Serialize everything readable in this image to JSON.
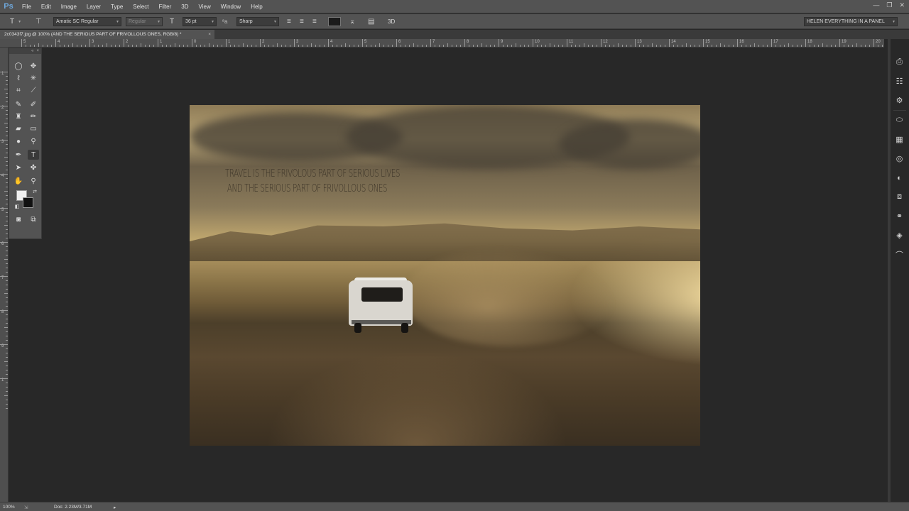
{
  "app": {
    "logo": "Ps"
  },
  "menu": [
    "File",
    "Edit",
    "Image",
    "Layer",
    "Type",
    "Select",
    "Filter",
    "3D",
    "View",
    "Window",
    "Help"
  ],
  "window_controls": [
    "—",
    "❐",
    "✕"
  ],
  "options": {
    "font_family": "Amatic SC Regular",
    "font_style": "Regular",
    "font_size": "36 pt",
    "aa_label": "ªa",
    "antialias": "Sharp",
    "warp_label": "3D",
    "text_color": "#1b1b1b",
    "workspace": "HELEN EVERYTHING IN A PANEL"
  },
  "document": {
    "tab_title": "2c0343f7.jpg @ 100% (AND THE SERIOUS PART OF FRIVOLLOUS ONES, RGB/8) *",
    "tab_close": "×"
  },
  "ruler": {
    "h_labels": [
      "5",
      "4",
      "3",
      "2",
      "1",
      "0",
      "1",
      "2",
      "3",
      "4",
      "5",
      "6",
      "7",
      "8",
      "9",
      "10",
      "11",
      "12",
      "13",
      "14",
      "15",
      "16",
      "17",
      "18",
      "19",
      "20"
    ],
    "v_labels": [
      "1",
      "2",
      "3",
      "4",
      "5",
      "6",
      "7",
      "8",
      "9",
      "1"
    ]
  },
  "canvas": {
    "quote_line1": "TRAVEL IS THE FRIVOLOUS PART OF SERIOUS LIVES",
    "quote_line2": " AND THE SERIOUS PART OF FRIVOLLOUS ONES"
  },
  "status": {
    "zoom": "100%",
    "doc_info": "Doc: 2.23M/3.71M",
    "arrow": "▸"
  },
  "colors": {
    "foreground": "#f0f0f0",
    "background": "#111111"
  }
}
